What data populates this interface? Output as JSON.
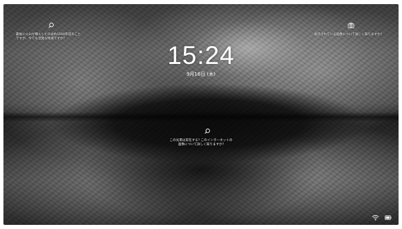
{
  "lock_screen": {
    "time": "15:24",
    "date": "9月16日 (木)",
    "spotlight_left": {
      "line1": "最後に火山が噴火したのは約1000年前のこと",
      "line2": "ですが、今でも活発な地域ですか？"
    },
    "spotlight_right": {
      "line1": "表示されている画像について詳しく知りますか?"
    },
    "spotlight_center": {
      "line1": "この光景は実在する? このインターネットの",
      "line2": "画像について詳しく知りますか?"
    },
    "icons": {
      "top_left": "search-icon",
      "top_right": "camera-icon",
      "center": "search-icon",
      "tray_network": "wifi-icon",
      "tray_battery": "battery-icon"
    }
  }
}
